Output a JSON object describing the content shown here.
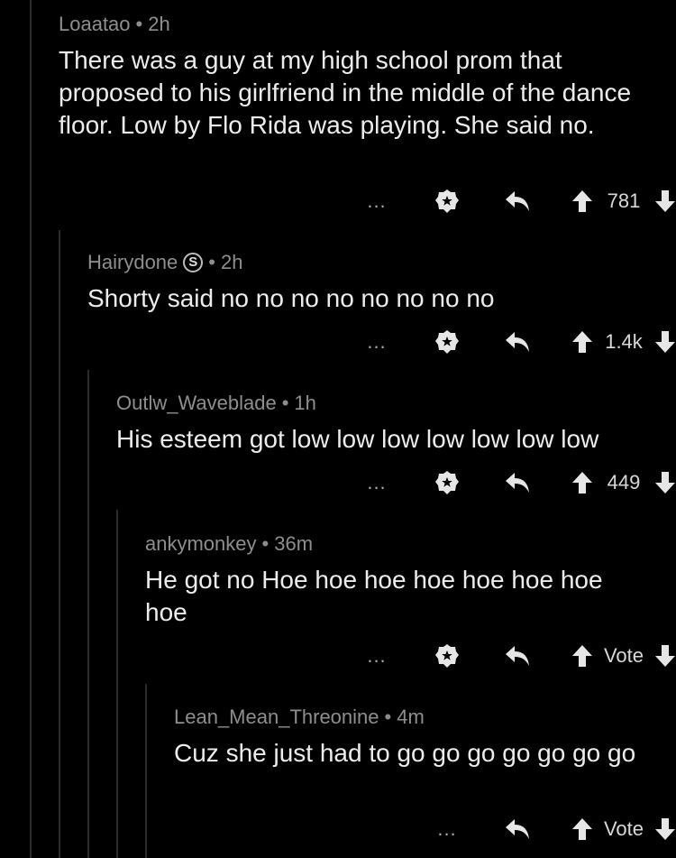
{
  "comments": [
    {
      "author": "Loaatao",
      "time": "2h",
      "body": "There was a guy at my high school prom that proposed to his girlfriend in the middle of the dance floor. Low by Flo Rida was playing. She said no.",
      "more": "...",
      "score": "781"
    },
    {
      "author": "Hairydone",
      "badge": "S",
      "time": "2h",
      "body": "Shorty said no no no no no no no no",
      "more": "...",
      "score": "1.4k"
    },
    {
      "author": "Outlw_Waveblade",
      "time": "1h",
      "body": "His esteem got low low low low low low low",
      "more": "...",
      "score": "449"
    },
    {
      "author": "ankymonkey",
      "time": "36m",
      "body": "He got no Hoe hoe hoe hoe hoe hoe hoe hoe",
      "more": "...",
      "score": "Vote"
    },
    {
      "author": "Lean_Mean_Threonine",
      "time": "4m",
      "body": "Cuz she just had to go go go go go go go",
      "more": "...",
      "score": "Vote"
    }
  ],
  "separator": "•",
  "icons": {
    "save": "star-badge-icon",
    "reply": "reply-arrow-icon",
    "up": "upvote-arrow-icon",
    "down": "downvote-arrow-icon"
  }
}
